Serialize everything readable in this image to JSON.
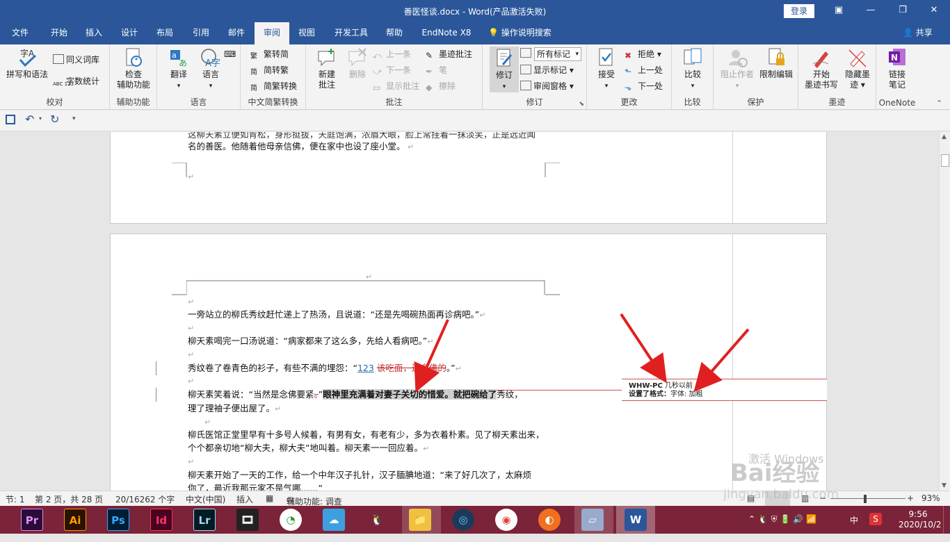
{
  "window": {
    "title": "善医怪谈.docx  -  Word(产品激活失败)",
    "login": "登录",
    "minimize": "—",
    "restore": "❐",
    "close": "✕"
  },
  "tabs": [
    "文件",
    "开始",
    "插入",
    "设计",
    "布局",
    "引用",
    "邮件",
    "审阅",
    "视图",
    "开发工具",
    "帮助",
    "EndNote X8"
  ],
  "tell_me": "操作说明搜索",
  "share": "共享",
  "ribbon": {
    "proofing": {
      "label": "校对",
      "spelling": "拼写和语法",
      "thesaurus": "同义词库",
      "wordcount": "字数统计"
    },
    "accessibility": {
      "label": "辅助功能",
      "check_1": "检查",
      "check_2": "辅助功能"
    },
    "language": {
      "label": "语言",
      "translate": "翻译",
      "language": "语言"
    },
    "chinese": {
      "label": "中文简繁转换",
      "t2s": "繁转简",
      "s2t": "简转繁",
      "convert": "简繁转换"
    },
    "comments": {
      "label": "批注",
      "new_1": "新建",
      "new_2": "批注",
      "delete": "删除",
      "prev": "上一条",
      "next": "下一条",
      "show": "显示批注",
      "ink": "墨迹批注",
      "pen": "笔",
      "erase": "擦除"
    },
    "tracking": {
      "label": "修订",
      "track": "修订",
      "markup_select": "所有标记",
      "show_markup": "显示标记",
      "review_pane": "审阅窗格"
    },
    "changes": {
      "label": "更改",
      "accept": "接受",
      "reject": "拒绝",
      "prev": "上一处",
      "next": "下一处"
    },
    "compare": {
      "label": "比较",
      "compare": "比较"
    },
    "protect": {
      "label": "保护",
      "block_authors": "阻止作者",
      "restrict": "限制编辑"
    },
    "ink": {
      "label": "墨迹",
      "start_1": "开始",
      "start_2": "墨迹书写",
      "hide_1": "隐藏墨",
      "hide_2": "迹"
    },
    "onenote": {
      "label": "OneNote",
      "link_1": "链接",
      "link_2": "笔记"
    }
  },
  "document": {
    "page1": {
      "line1": "这柳天素立便如肯松，身形挺拔，天庭饱满，浓眉大眼，脸上常挂着一抹淡笑，正是远近闻",
      "line2": "名的善医。他随着他母亲信佛，便在家中也设了座小堂。"
    },
    "page2": {
      "p1": "一旁站立的柳氏秀纹赶忙递上了热汤，且说道：“还是先喝碗热面再诊病吧。”",
      "p2": "柳天素喝完一口汤说道：“病家都来了这么多，先给人看病吧。”",
      "p3_pre": "秀纹卷了卷青色的衫子，有些不满的埋怨：“",
      "p3_ins": "123",
      "p3_del": "该吃面，还念佛的",
      "p3_post": "。”",
      "p4_pre": "柳天素笑着说：“当然是念佛要紧",
      "p4_del": "。",
      "p4_q": "”",
      "p4_bold": "眼神里充满着对妻子关切的惜爱。就把碗给了",
      "p4_post": "秀纹，",
      "p4_line2": "理了理袖子便出屋了。",
      "p5_1": "柳氏医馆正堂里早有十多号人候着，有男有女，有老有少，多为衣着朴素。见了柳天素出来，",
      "p5_2": "个个都亲切地“柳大夫，柳大夫”地叫着。柳天素一一回应着。",
      "p6_1": "柳天素开始了一天的工作，给一个中年汉子扎针，汉子腼腆地道：“来了好几次了，太麻烦",
      "p6_2": "你了，最近我那元家不是气哪……”"
    },
    "comment": {
      "author": "WHW-PC",
      "time": "几秒以前",
      "label": "设置了格式：",
      "detail": "字体: 加粗"
    }
  },
  "status": {
    "section": "节: 1",
    "page": "第 2 页，共 28 页",
    "words": "20/16262 个字",
    "lang": "中文(中国)",
    "insert": "插入",
    "accessibility": "辅助功能: 调查",
    "zoom": "93%"
  },
  "taskbar": {
    "apps": [
      "Pr",
      "Ai",
      "Ps",
      "Id",
      "Lr"
    ],
    "time": "9:56",
    "date": "2020/10/2",
    "ime": "中"
  },
  "watermark": {
    "line1": "激活 Windows",
    "brand": "Bai经验",
    "url": "jingyan.baidu.com"
  },
  "colors": {
    "brand": "#2b579a",
    "taskbar": "#7b2338",
    "arrow": "#e02020"
  }
}
